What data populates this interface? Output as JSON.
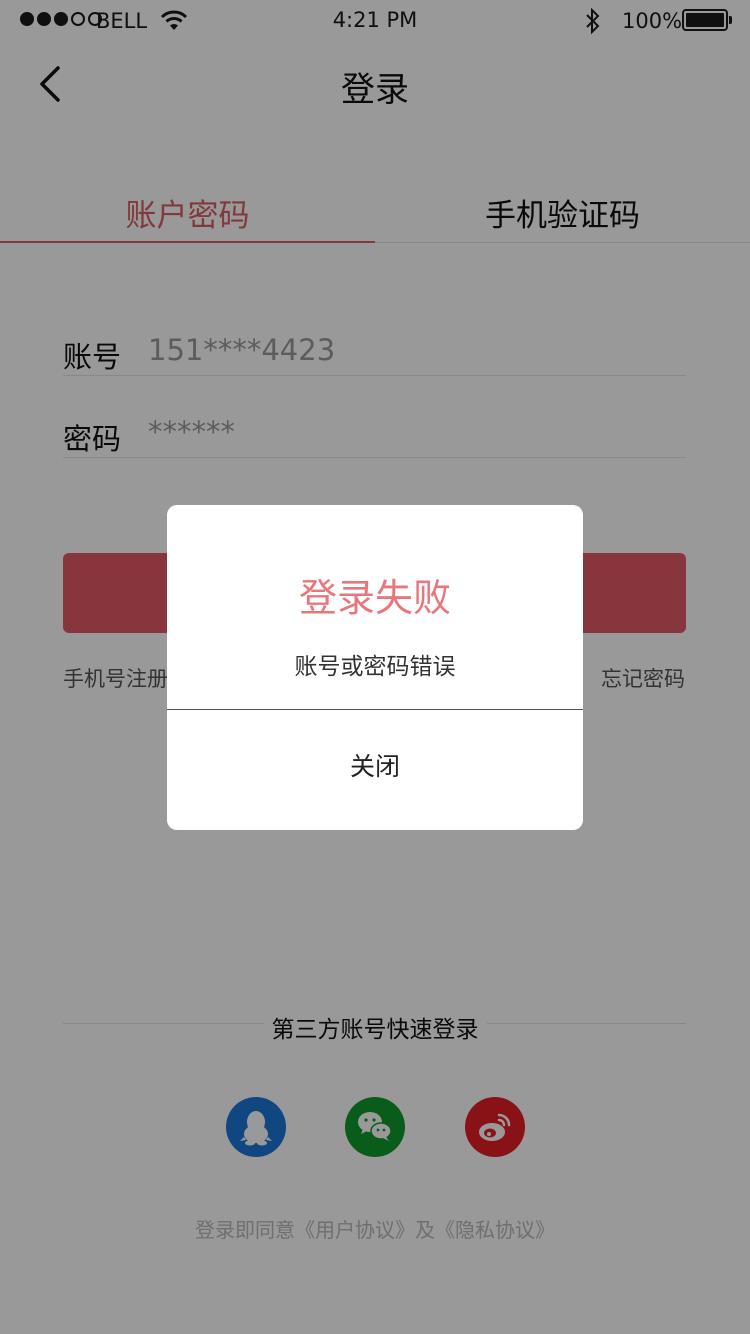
{
  "status_bar": {
    "carrier": "BELL",
    "time": "4:21 PM",
    "battery": "100%"
  },
  "nav": {
    "title": "登录"
  },
  "tabs": [
    {
      "label": "账户密码",
      "active": true
    },
    {
      "label": "手机验证码",
      "active": false
    }
  ],
  "form": {
    "account_label": "账号",
    "account_value": "151****4423",
    "password_label": "密码",
    "password_value": "******"
  },
  "links": {
    "register": "手机号注册",
    "forgot": "忘记密码"
  },
  "third_party": {
    "title": "第三方账号快速登录",
    "icons": [
      "qq-icon",
      "wechat-icon",
      "weibo-icon"
    ]
  },
  "agreement": "登录即同意《用户协议》及《隐私协议》",
  "dialog": {
    "title": "登录失败",
    "message": "账号或密码错误",
    "close_label": "关闭"
  },
  "colors": {
    "accent": "#d85f66",
    "button": "#e35b66",
    "dialog_title": "#e8777d",
    "qq": "#1b77d8",
    "wechat": "#119a2e",
    "weibo": "#e51f27"
  }
}
